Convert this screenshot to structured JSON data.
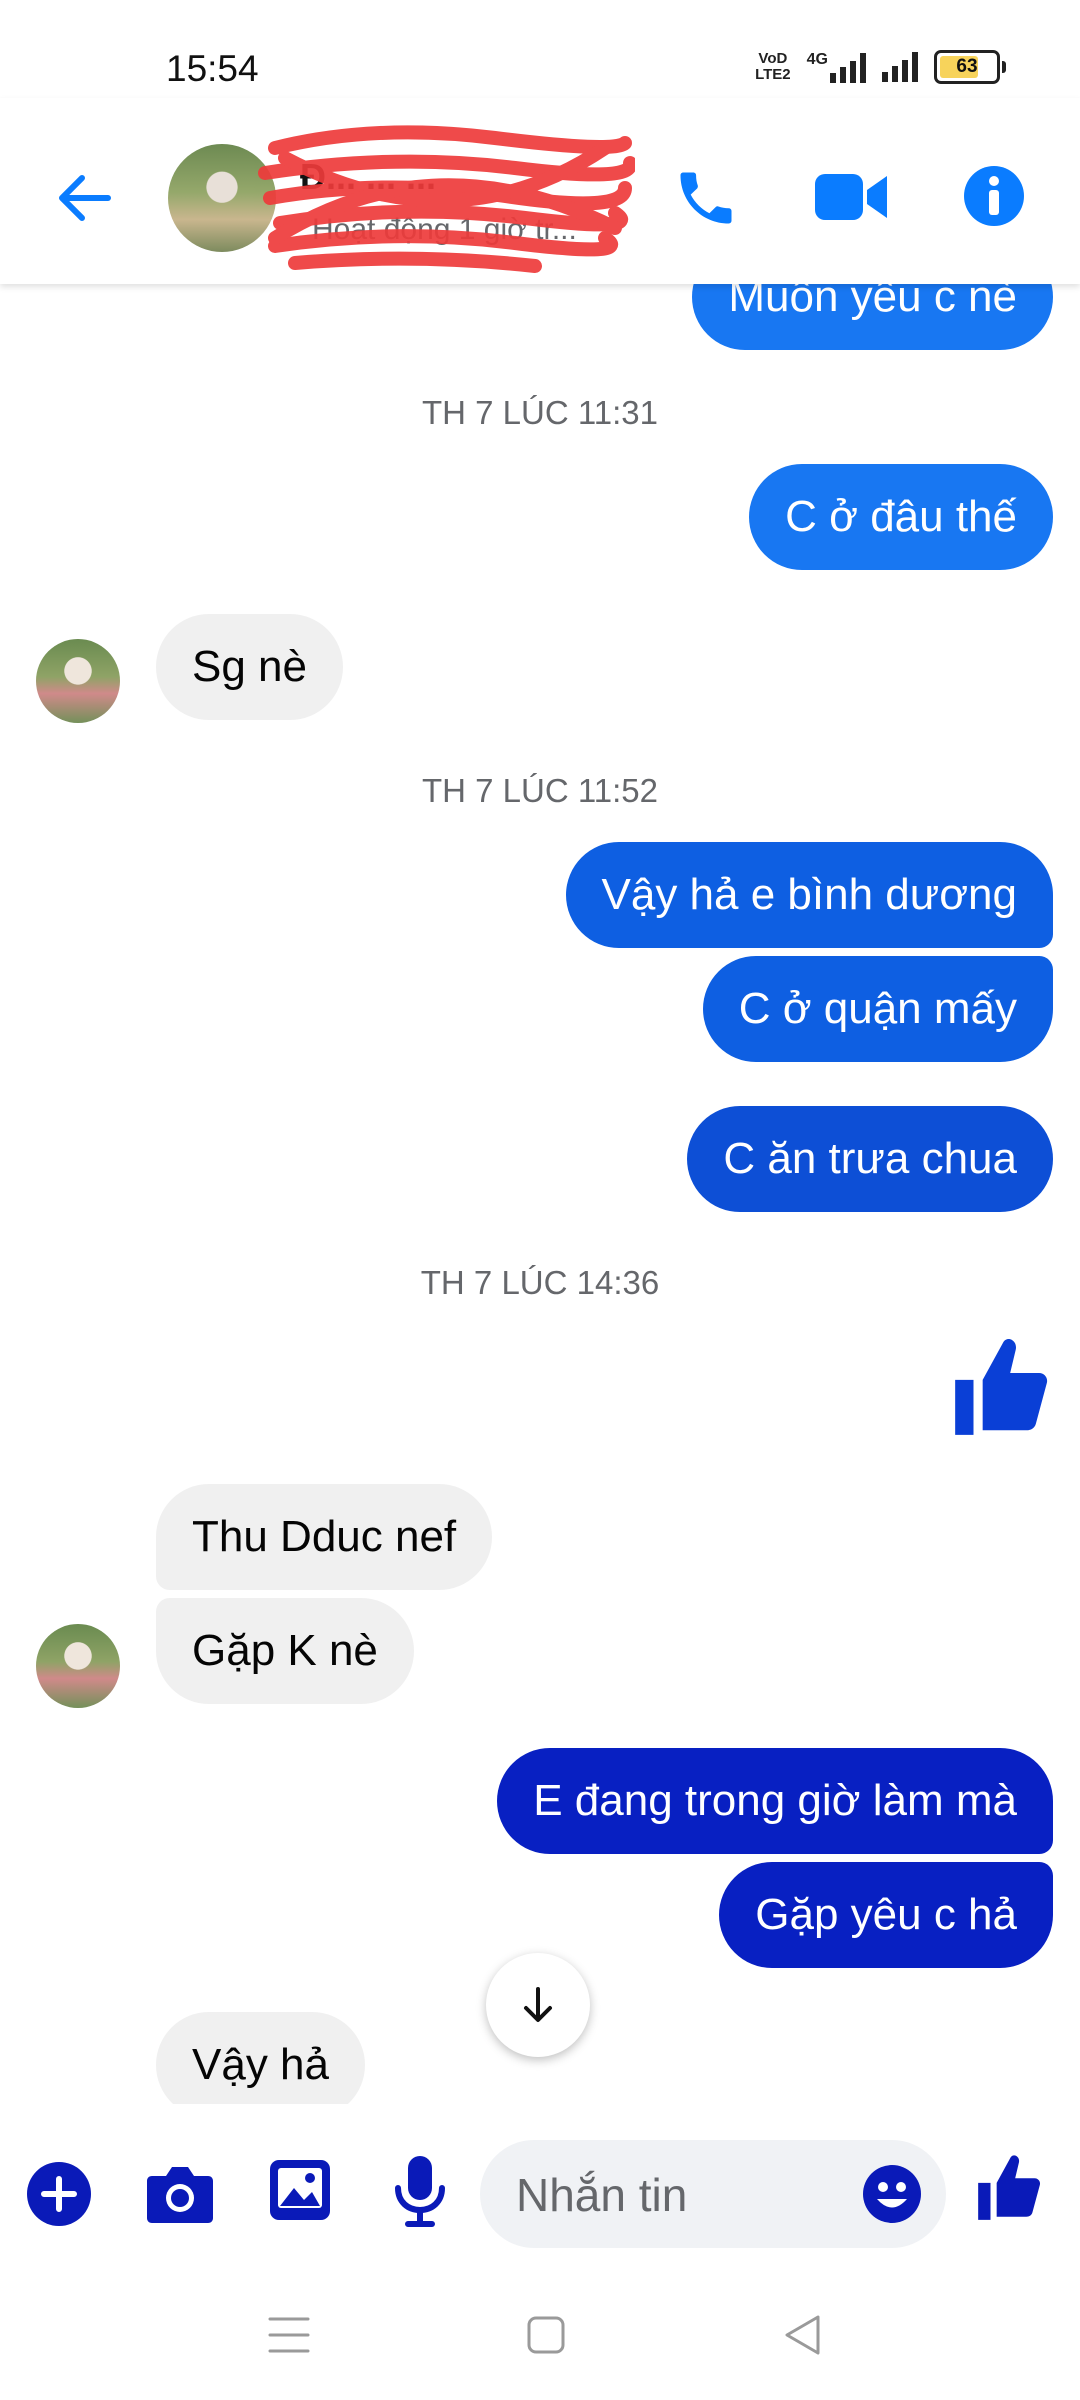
{
  "status_bar": {
    "time": "15:54",
    "volte_label": "VoD LTE2",
    "network": "4G",
    "battery": "63",
    "battery_level": 0.63
  },
  "header": {
    "contact_name": "Đ... ... ...",
    "contact_status": "Hoạt động 1 giờ tr...",
    "icons": [
      "back-arrow-icon",
      "phone-icon",
      "video-camera-icon",
      "info-icon"
    ],
    "accent": "#0a7cff"
  },
  "chat": {
    "messages": [
      {
        "type": "out",
        "text": "Muốn yêu c nè",
        "color": "#1877f2"
      },
      {
        "type": "timestamp",
        "text": "TH 7 LÚC 11:31"
      },
      {
        "type": "out",
        "text": "C ở đâu thế",
        "color": "#1877f2"
      },
      {
        "type": "in",
        "text": "Sg nè"
      },
      {
        "type": "timestamp",
        "text": "TH 7 LÚC 11:52"
      },
      {
        "type": "out",
        "text": "Vậy hả e bình dương",
        "color": "#0e5fe2"
      },
      {
        "type": "out",
        "text": "C ở quận mấy",
        "color": "#0e5fe2"
      },
      {
        "type": "out",
        "text": "C ăn trưa chua",
        "color": "#0d4fd6"
      },
      {
        "type": "timestamp",
        "text": "TH 7 LÚC 14:36"
      },
      {
        "type": "like"
      },
      {
        "type": "in",
        "text": "Thu Dduc nef"
      },
      {
        "type": "in",
        "text": "Gặp K nè"
      },
      {
        "type": "out",
        "text": "E đang trong giờ làm mà",
        "color": "#0820c2"
      },
      {
        "type": "out",
        "text": "Gặp yêu c hả",
        "color": "#0820c2"
      },
      {
        "type": "in",
        "text": "Vậy hả"
      }
    ]
  },
  "composer": {
    "placeholder": "Nhắn tin",
    "icons": [
      "plus-icon",
      "camera-icon",
      "image-icon",
      "microphone-icon",
      "emoji-icon",
      "like-icon"
    ],
    "color": "#0a1ab8"
  },
  "nav_bar": {
    "icons": [
      "menu-icon",
      "home-square-icon",
      "back-triangle-icon"
    ]
  }
}
